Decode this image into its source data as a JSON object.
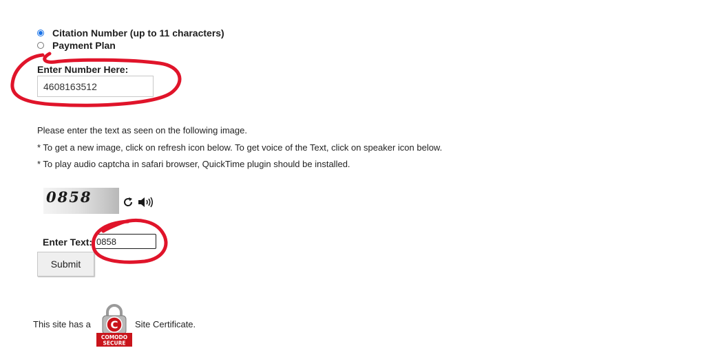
{
  "form": {
    "radio_options": [
      {
        "label": "Citation Number (up to 11 characters)",
        "checked": true
      },
      {
        "label": "Payment Plan",
        "checked": false
      }
    ],
    "number_label": "Enter Number Here:",
    "number_value": "4608163512"
  },
  "instructions": [
    "Please enter the text as seen on the following image.",
    "* To get a new image, click on refresh icon below. To get voice of the Text, click on speaker icon below.",
    "* To play audio captcha in safari browser, QuickTime plugin should be installed."
  ],
  "captcha": {
    "image_text": "0858",
    "refresh_icon": "refresh-icon",
    "speaker_icon": "speaker-icon",
    "enter_text_label": "Enter Text:",
    "input_value": "0858"
  },
  "submit_label": "Submit",
  "certificate": {
    "text_before": "This site has a",
    "seal_line_1": "COMODO",
    "seal_line_2": "SECURE",
    "text_after": "Site Certificate."
  },
  "colors": {
    "annotation_red": "#e0142a",
    "radio_checked": "#1a73e8",
    "seal_red": "#c9141b"
  }
}
